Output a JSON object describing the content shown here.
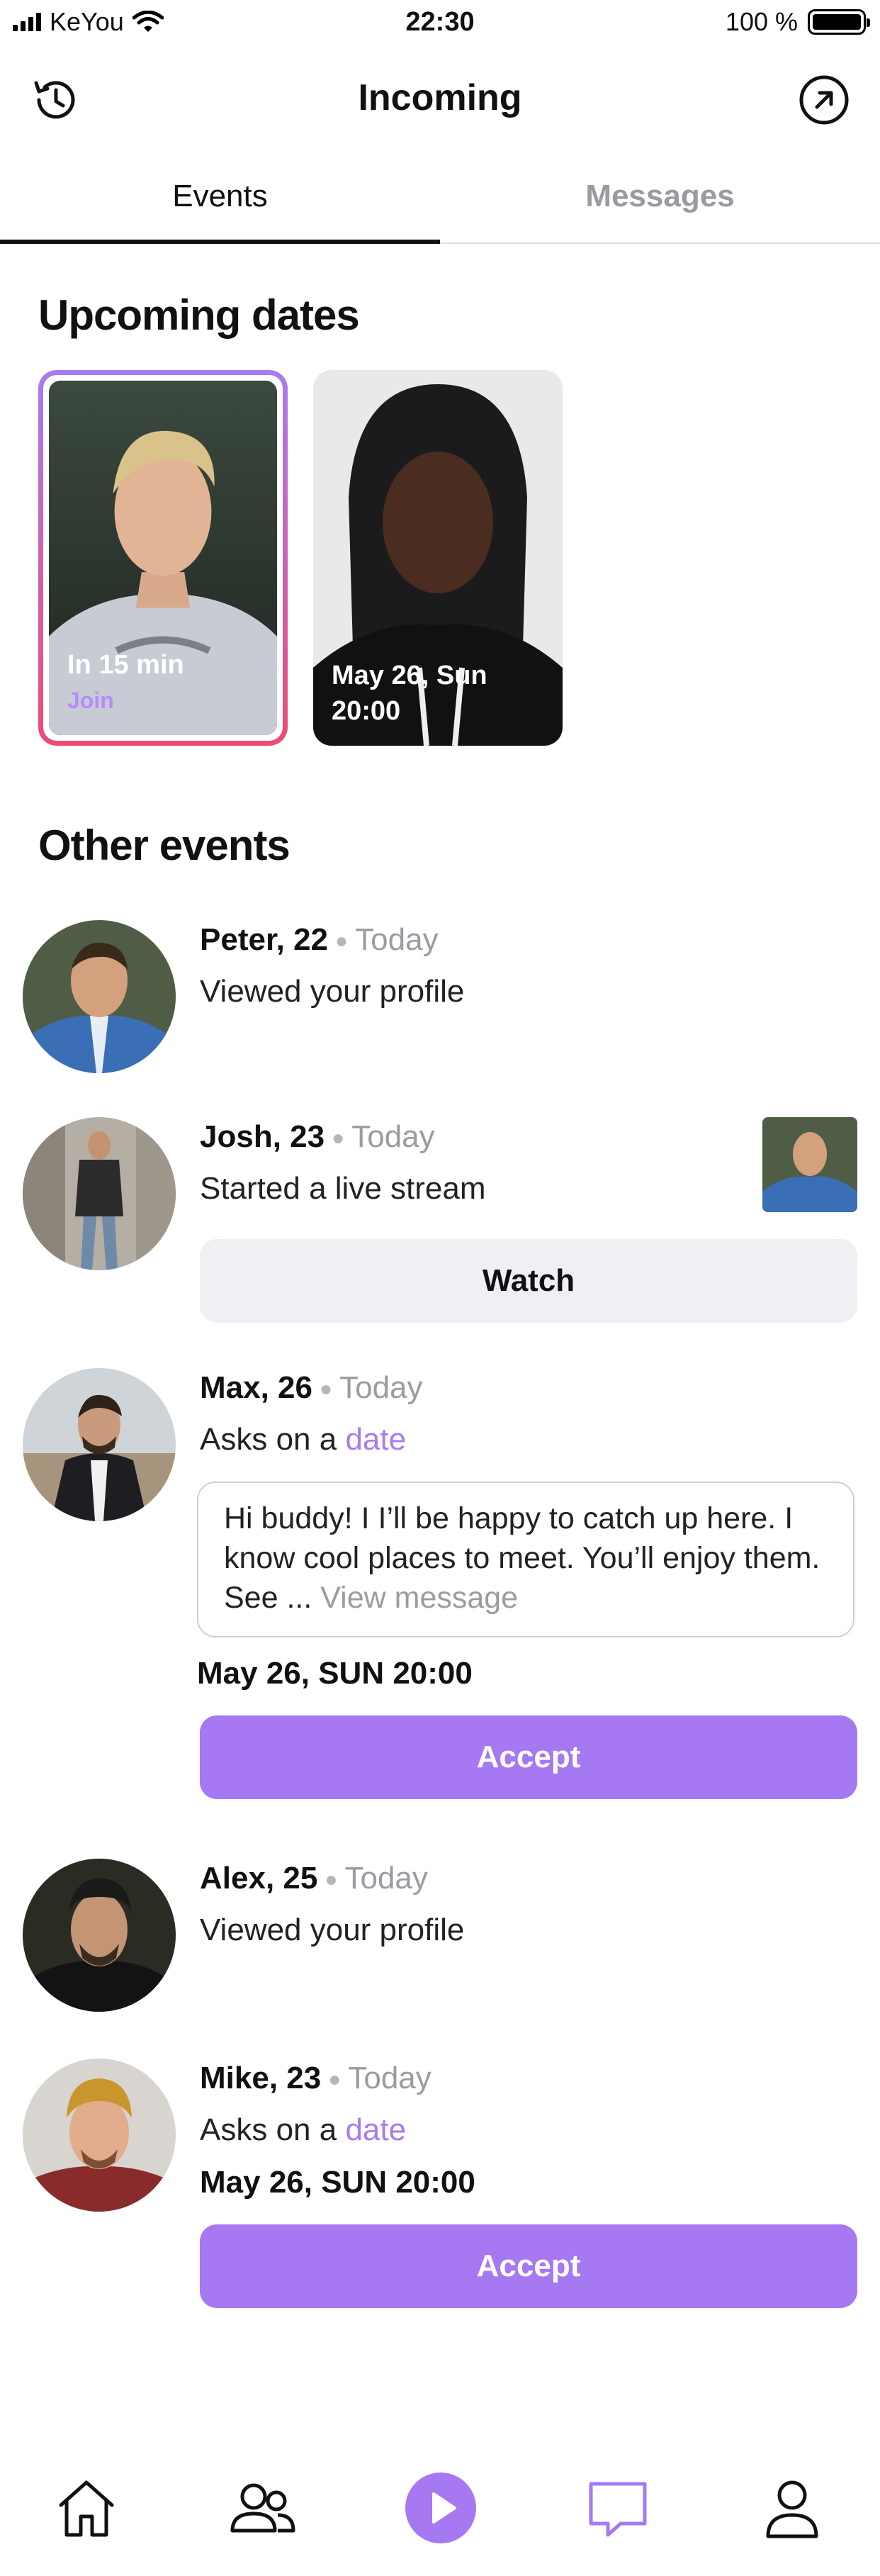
{
  "status_bar": {
    "carrier": "KeYou",
    "time": "22:30",
    "battery": "100 %",
    "battery_level": 1.0
  },
  "header": {
    "title": "Incoming",
    "left_icon": "history-icon",
    "right_icon": "arrow-up-right-circle-icon"
  },
  "tabs": [
    {
      "label": "Events",
      "active": true
    },
    {
      "label": "Messages",
      "active": false
    }
  ],
  "upcoming": {
    "title": "Upcoming dates",
    "cards": [
      {
        "line1": "In 15 min",
        "line2": "Join",
        "active": true
      },
      {
        "line1": "May 26, Sun",
        "line2": "20:00",
        "active": false
      }
    ]
  },
  "other": {
    "title": "Other events",
    "events": [
      {
        "name": "Peter, 22",
        "when": "Today",
        "text": "Viewed your profile"
      },
      {
        "name": "Josh, 23",
        "when": "Today",
        "text": "Started a live stream",
        "button": "Watch"
      },
      {
        "name": "Max, 26",
        "when": "Today",
        "text_prefix": "Asks on a",
        "text_accent": "date",
        "message": "Hi buddy! I I’ll be happy to catch up here. I know cool places to meet. You’ll enjoy them. See ...",
        "message_link": "View  message",
        "date": "May 26, SUN 20:00",
        "button": "Accept"
      },
      {
        "name": "Alex, 25",
        "when": "Today",
        "text": "Viewed your profile"
      },
      {
        "name": "Mike, 23",
        "when": "Today",
        "text_prefix": "Asks on a",
        "text_accent": "date",
        "date": "May 26, SUN 20:00",
        "button": "Accept"
      }
    ]
  },
  "bottom_nav": [
    {
      "icon": "home-icon"
    },
    {
      "icon": "people-icon"
    },
    {
      "icon": "play-icon"
    },
    {
      "icon": "chat-icon",
      "active": true
    },
    {
      "icon": "profile-icon"
    }
  ],
  "colors": {
    "accent": "#a678f2",
    "gradient_start": "#a97bf0",
    "gradient_end": "#ee4a74",
    "muted": "#9b9ba3"
  }
}
